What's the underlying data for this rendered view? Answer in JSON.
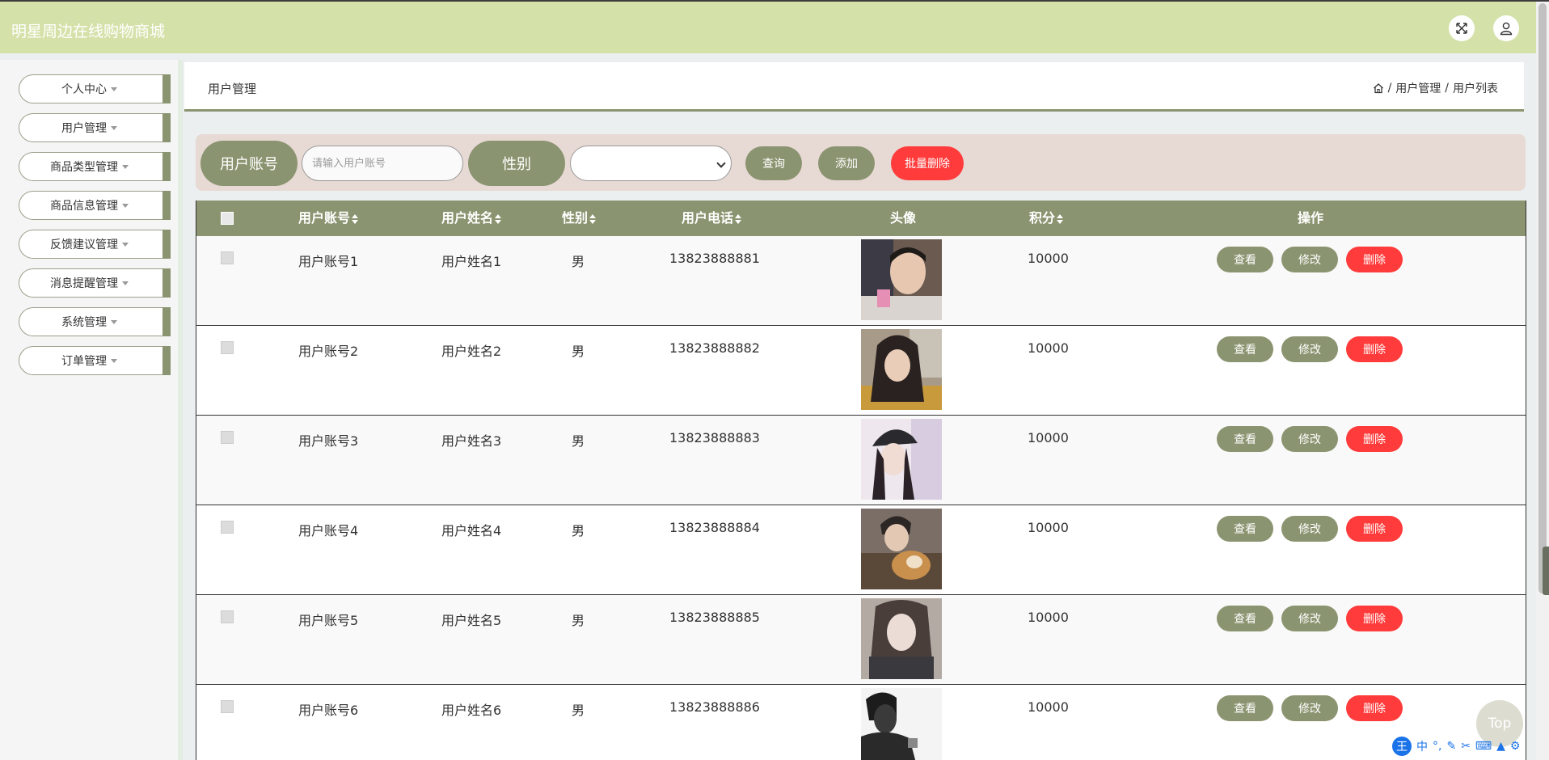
{
  "app": {
    "title": "明星周边在线购物商城"
  },
  "topbar": {
    "fullscreen_icon": "expand-icon",
    "user_icon": "user-icon"
  },
  "sidebar": {
    "items": [
      {
        "label": "个人中心"
      },
      {
        "label": "用户管理"
      },
      {
        "label": "商品类型管理"
      },
      {
        "label": "商品信息管理"
      },
      {
        "label": "反馈建议管理"
      },
      {
        "label": "消息提醒管理"
      },
      {
        "label": "系统管理"
      },
      {
        "label": "订单管理"
      }
    ]
  },
  "breadcrumb": {
    "title": "用户管理",
    "sep": "/",
    "home_icon": "home-icon",
    "path": [
      "用户管理",
      "用户列表"
    ]
  },
  "search": {
    "account_label": "用户账号",
    "account_placeholder": "请输入用户账号",
    "account_value": "",
    "gender_label": "性别",
    "gender_value": "",
    "query_button": "查询",
    "add_button": "添加",
    "batch_delete_button": "批量删除"
  },
  "table": {
    "headers": [
      "用户账号",
      "用户姓名",
      "性别",
      "用户电话",
      "头像",
      "积分",
      "操作"
    ],
    "rows": [
      {
        "account": "用户账号1",
        "name": "用户姓名1",
        "gender": "男",
        "phone": "13823888881",
        "points": "10000"
      },
      {
        "account": "用户账号2",
        "name": "用户姓名2",
        "gender": "男",
        "phone": "13823888882",
        "points": "10000"
      },
      {
        "account": "用户账号3",
        "name": "用户姓名3",
        "gender": "男",
        "phone": "13823888883",
        "points": "10000"
      },
      {
        "account": "用户账号4",
        "name": "用户姓名4",
        "gender": "男",
        "phone": "13823888884",
        "points": "10000"
      },
      {
        "account": "用户账号5",
        "name": "用户姓名5",
        "gender": "男",
        "phone": "13823888885",
        "points": "10000"
      },
      {
        "account": "用户账号6",
        "name": "用户姓名6",
        "gender": "男",
        "phone": "13823888886",
        "points": "10000"
      }
    ],
    "actions": {
      "view": "查看",
      "edit": "修改",
      "delete": "删除"
    }
  },
  "back_to_top": "Top",
  "ime": {
    "lang": "中",
    "logo": "王"
  },
  "colors": {
    "accent": "#8b9470",
    "danger": "#ff3b3b",
    "topbar": "#d4e2aa",
    "searchbar": "#e7d9d4"
  }
}
